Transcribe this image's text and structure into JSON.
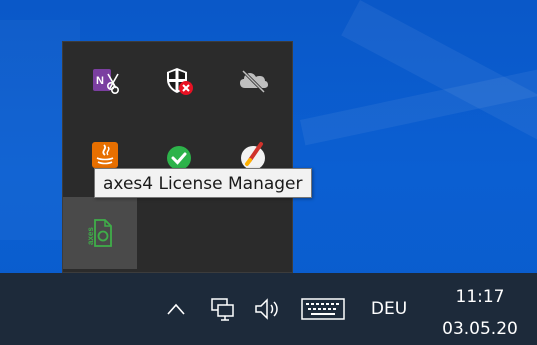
{
  "tooltip": {
    "text": "axes4 License Manager"
  },
  "tray_flyout": {
    "icons": [
      {
        "name": "onenote-send-icon",
        "color": "#7b3fa0"
      },
      {
        "name": "windows-security-warning-icon",
        "color": "#e81123"
      },
      {
        "name": "onedrive-offline-icon",
        "color": "#c8c8c8"
      },
      {
        "name": "java-icon",
        "color": "#e76f00"
      },
      {
        "name": "green-check-icon",
        "color": "#2db34a"
      },
      {
        "name": "paint-brush-icon",
        "color": "#d0322b"
      },
      {
        "name": "axes4-license-manager-icon",
        "color": "#3fae49"
      }
    ]
  },
  "taskbar": {
    "show_hidden_icons": "^",
    "language": "DEU",
    "clock_time": "11:17",
    "clock_date": "03.05.20",
    "colors": {
      "background": "#1d2a3a",
      "foreground": "#ffffff"
    }
  }
}
